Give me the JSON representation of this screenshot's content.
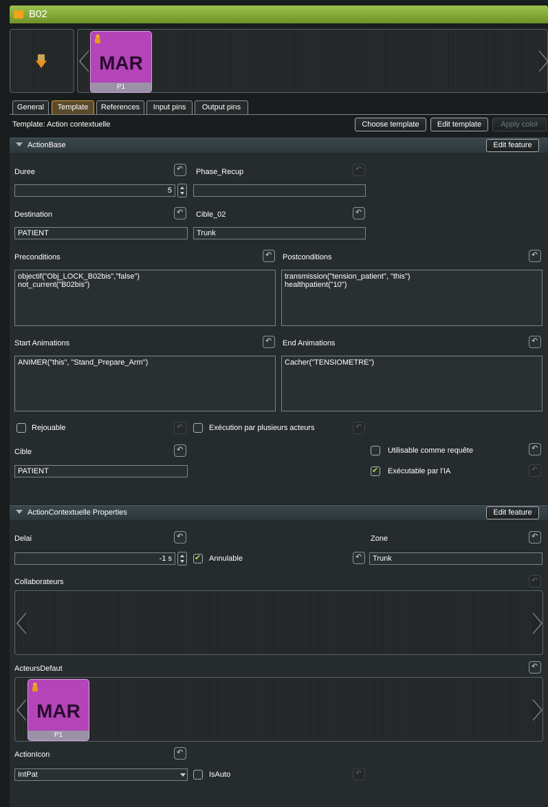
{
  "window": {
    "title": "B02"
  },
  "actor_card": {
    "name": "MAR",
    "slot": "P1"
  },
  "tabs": [
    {
      "label": "General",
      "active": false
    },
    {
      "label": "Template",
      "active": true
    },
    {
      "label": "References",
      "active": false
    },
    {
      "label": "Input pins",
      "active": false
    },
    {
      "label": "Output pins",
      "active": false
    }
  ],
  "template_bar": {
    "label": "Template: Action contextuelle",
    "choose_label": "Choose template",
    "edit_label": "Edit template",
    "apply_color_label": "Apply color"
  },
  "action_base": {
    "title": "ActionBase",
    "edit_feature_label": "Edit feature",
    "duree": {
      "label": "Duree",
      "value": "5"
    },
    "phase_recup": {
      "label": "Phase_Recup",
      "value": ""
    },
    "destination": {
      "label": "Destination",
      "value": "PATIENT"
    },
    "cible_02": {
      "label": "Cible_02",
      "value": "Trunk"
    },
    "preconditions": {
      "label": "Preconditions",
      "value": "objectif(\"Obj_LOCK_B02bis\",\"false\")\nnot_current(\"B02bis\")"
    },
    "postconditions": {
      "label": "Postconditions",
      "value": "transmission(\"tension_patient\", \"this\")\nhealthpatient(\"10\")"
    },
    "start_animations": {
      "label": "Start Animations",
      "value": "ANIMER(\"this\", \"Stand_Prepare_Arm\")"
    },
    "end_animations": {
      "label": "End Animations",
      "value": "Cacher(\"TENSIOMETRE\")"
    },
    "rejouable": {
      "label": "Rejouable",
      "checked": false
    },
    "execution_plusieurs": {
      "label": "Exécution par plusieurs acteurs",
      "checked": false
    },
    "cible": {
      "label": "Cible",
      "value": "PATIENT"
    },
    "utilisable_requete": {
      "label": "Utilisable comme requête",
      "checked": false
    },
    "executable_ia": {
      "label": "Exécutable par l'IA",
      "checked": true
    }
  },
  "action_contextuelle": {
    "title": "ActionContextuelle Properties",
    "edit_feature_label": "Edit feature",
    "delai": {
      "label": "Delai",
      "value": "-1 s"
    },
    "annulable": {
      "label": "Annulable",
      "checked": true
    },
    "zone": {
      "label": "Zone",
      "value": "Trunk"
    },
    "collaborateurs": {
      "label": "Collaborateurs"
    },
    "acteurs_defaut": {
      "label": "ActeursDefaut"
    },
    "action_icon": {
      "label": "ActionIcon",
      "value": "IntPat"
    },
    "is_auto": {
      "label": "IsAuto",
      "checked": false
    }
  },
  "colors": {
    "title_bar": "#8cb83e",
    "card": "#b345b8",
    "accent_check": "#b9d84a",
    "tab_active": "#d8a53a"
  }
}
